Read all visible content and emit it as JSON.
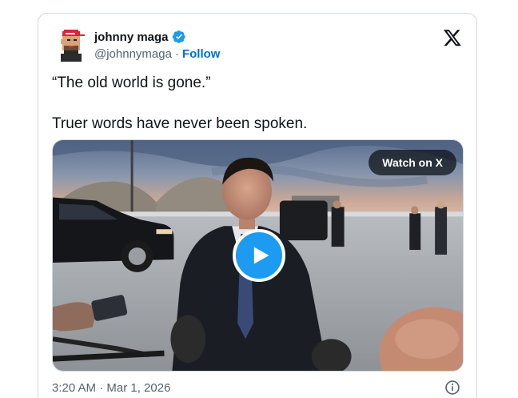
{
  "author": {
    "display_name": "johnny maga",
    "handle": "@johnnymaga",
    "separator": "·",
    "follow_label": "Follow",
    "verified": true,
    "avatar_icon": "pixel-avatar-red-cap",
    "verified_icon": "verified-badge-icon"
  },
  "tweet": {
    "line1": "“The old world is gone.”",
    "line2": "Truer words have never been spoken."
  },
  "media": {
    "watch_label": "Watch on X",
    "play_icon": "play-icon",
    "media_type": "video"
  },
  "footer": {
    "timestamp": "3:20 AM · Mar 1, 2026",
    "info_icon": "info-icon"
  },
  "colors": {
    "follow_link": "#006fd6",
    "play_button": "#1d9bf0",
    "verified": "#1d9bf0",
    "muted_text": "#536471",
    "border": "#cfd9de"
  }
}
